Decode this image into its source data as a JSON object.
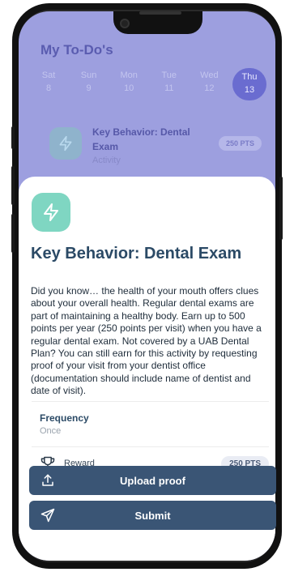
{
  "colors": {
    "background_overlay": "#9d9fdf",
    "primary_button": "#3a5575",
    "title_text": "#2b4a66",
    "bolt_tile": "#7fd6c2"
  },
  "background": {
    "title": "My To-Do's",
    "days": [
      {
        "name": "Sat",
        "num": "8"
      },
      {
        "name": "Sun",
        "num": "9"
      },
      {
        "name": "Mon",
        "num": "10"
      },
      {
        "name": "Tue",
        "num": "11"
      },
      {
        "name": "Wed",
        "num": "12"
      },
      {
        "name": "Thu",
        "num": "13",
        "selected": true
      }
    ],
    "card": {
      "title": "Key Behavior: Dental Exam",
      "subtitle": "Activity",
      "points": "250 PTS",
      "icon": "bolt-icon"
    }
  },
  "sheet": {
    "icon": "bolt-icon",
    "title": "Key Behavior: Dental Exam",
    "description": "Did you know… the health of your mouth offers clues about your overall health. Regular dental exams are part of maintaining a healthy body. Earn up to 500 points per year (250 points per visit) when you have a regular dental exam. Not covered by a UAB Dental Plan? You can still earn for this activity by requesting proof of your visit from your dentist office (documentation should include name of dentist and date of visit).",
    "frequency_label": "Frequency",
    "frequency_value": "Once",
    "reward_label": "Reward",
    "reward_icon": "trophy-icon",
    "reward_points": "250 PTS"
  },
  "actions": {
    "upload_label": "Upload proof",
    "upload_icon": "upload-icon",
    "submit_label": "Submit",
    "submit_icon": "send-icon"
  }
}
